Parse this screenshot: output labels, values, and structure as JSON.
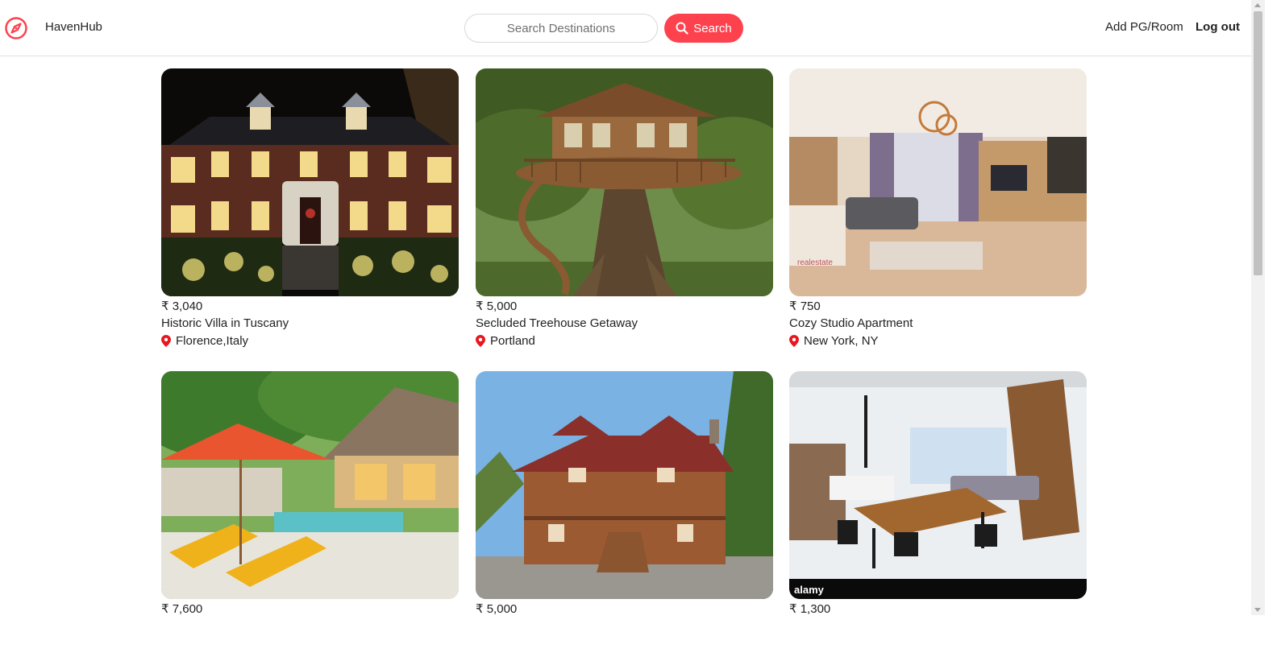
{
  "brand": {
    "name": "HavenHub",
    "accent_color": "#fe424d"
  },
  "search": {
    "placeholder": "Search Destinations",
    "value": "",
    "button_label": "Search"
  },
  "nav": {
    "add_label": "Add PG/Room",
    "logout_label": "Log out"
  },
  "listings": [
    {
      "price": "₹ 3,040",
      "title": "Historic Villa in Tuscany",
      "location": "Florence,Italy",
      "image": "brick-mansion-night"
    },
    {
      "price": "₹ 5,000",
      "title": "Secluded Treehouse Getaway",
      "location": "Portland",
      "image": "treehouse-in-giant-tree"
    },
    {
      "price": "₹ 750",
      "title": "Cozy Studio Apartment",
      "location": "New York, NY",
      "image": "modern-studio-interior"
    },
    {
      "price": "₹ 7,600",
      "title": "",
      "location": "",
      "image": "tropical-bungalow-pool"
    },
    {
      "price": "₹ 5,000",
      "title": "",
      "location": "",
      "image": "log-cabin-forest"
    },
    {
      "price": "₹ 1,300",
      "title": "",
      "location": "",
      "image": "loft-dining-interior"
    }
  ]
}
